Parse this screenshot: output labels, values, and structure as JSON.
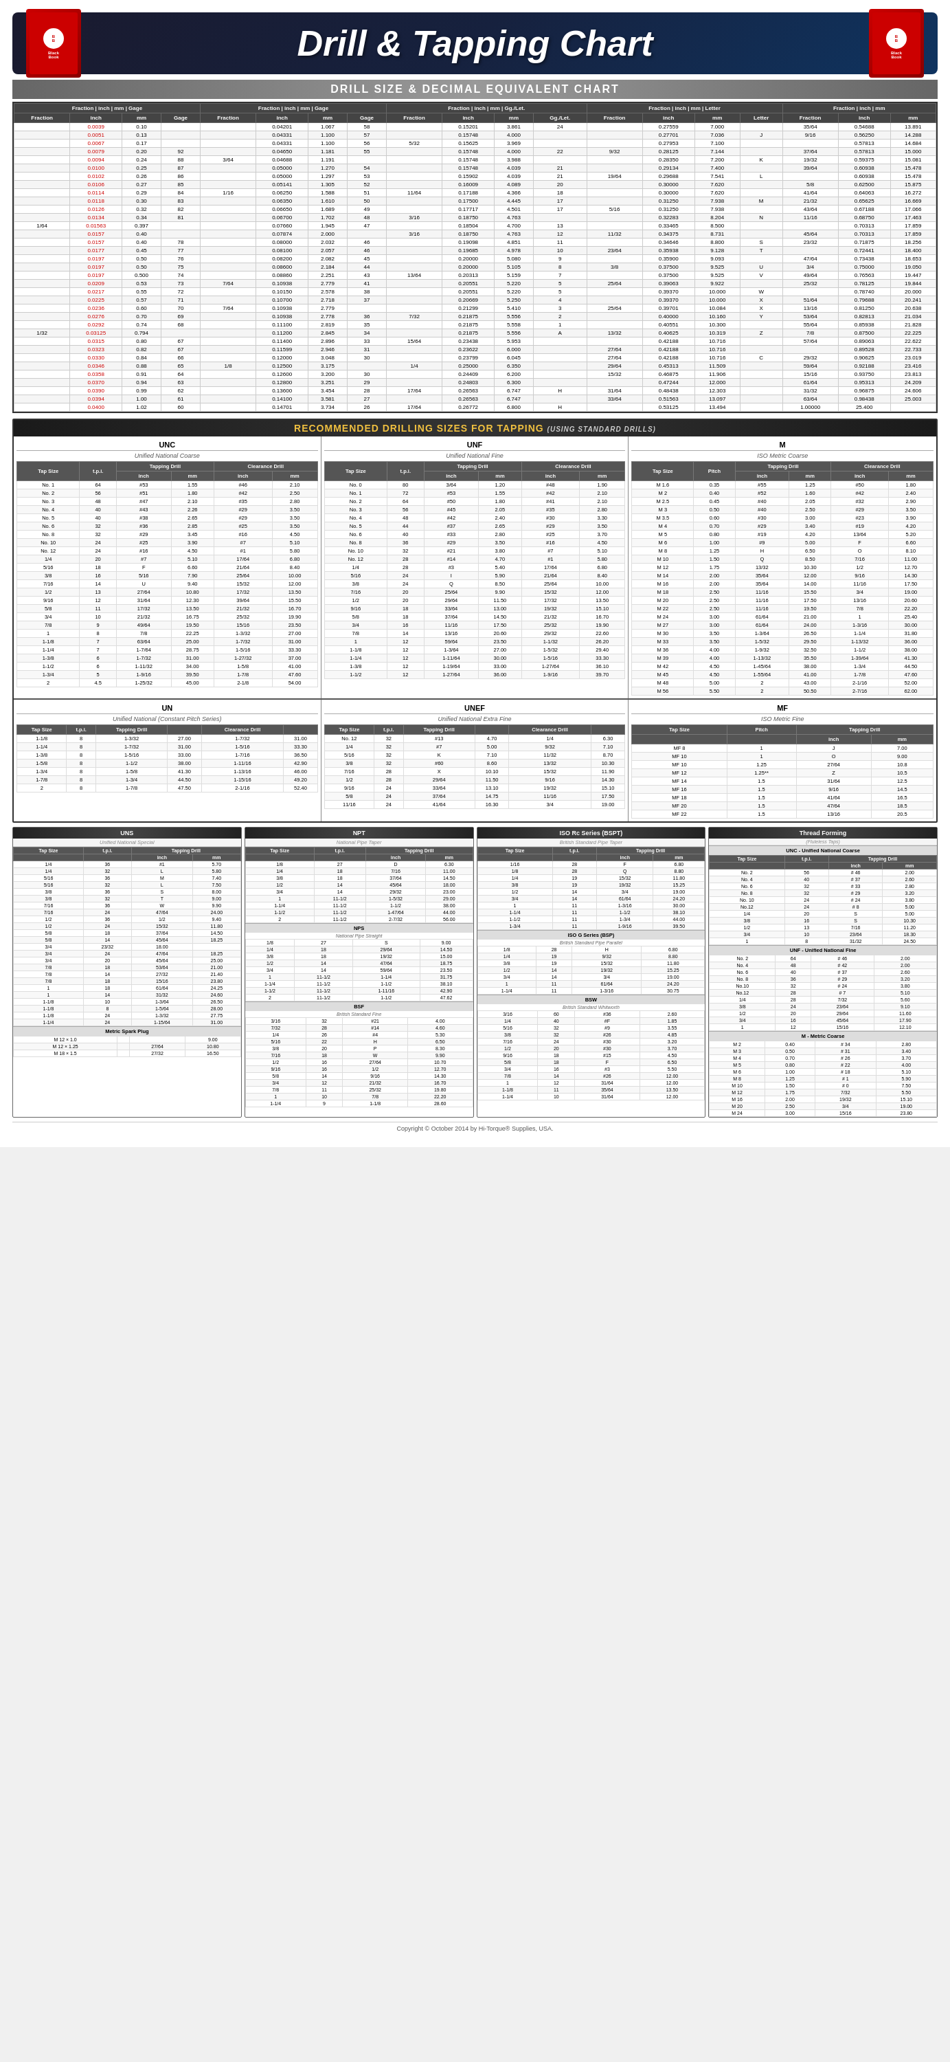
{
  "header": {
    "title": "Drill & Tapping Chart",
    "subtitle": "DRILL SIZE & DECIMAL EQUIVALENT CHART",
    "book_label": "Black Book",
    "drill_subtitle": "RECOMMENDED DRILLING SIZES FOR TAPPING (USING STANDARD DRILLS)"
  },
  "main_table_headers": [
    "Fraction",
    "inch",
    "mm",
    "Gage",
    "Fraction",
    "inch",
    "mm",
    "Gage",
    "Fraction",
    "inch",
    "mm",
    "Gg./Let.",
    "Fraction",
    "inch",
    "mm",
    "Letter",
    "Fraction",
    "inch",
    "mm"
  ],
  "unc_section": {
    "title": "UNC",
    "subtitle": "Unified National Coarse",
    "columns": [
      "Tap Size",
      "t.p.i.",
      "Tapping Drill inch",
      "Tapping Drill mm",
      "Clearance Drill inch",
      "Clearance Drill mm"
    ]
  },
  "unf_section": {
    "title": "UNF",
    "subtitle": "Unified National Fine",
    "columns": [
      "Tap Size",
      "t.p.i.",
      "Tapping Drill inch",
      "Tapping Drill mm",
      "Clearance Drill inch",
      "Clearance Drill mm"
    ]
  },
  "m_section": {
    "title": "M",
    "subtitle": "ISO Metric Coarse",
    "columns": [
      "Tap Size",
      "Pitch",
      "Tapping Drill inch",
      "Tapping Drill mm",
      "Clearance Drill inch",
      "Clearance Drill mm"
    ]
  },
  "un_section": {
    "title": "UN",
    "subtitle": "Unified National (Constant Pitch Series)"
  },
  "unef_section": {
    "title": "UNEF",
    "subtitle": "Unified National Extra Fine"
  },
  "mf_section": {
    "title": "MF",
    "subtitle": "ISO Metric Fine"
  },
  "uns_section": {
    "title": "UNS",
    "subtitle": "Unified National Special"
  },
  "npt_section": {
    "title": "NPT",
    "subtitle": "National Pipe Taper"
  },
  "iso_rc_section": {
    "title": "ISO Rc Series (BSPT)",
    "subtitle": "British Standard Pipe Taper"
  },
  "thread_forming": {
    "title": "Thread Forming",
    "subtitle": "(Fluteless Taps)"
  },
  "metric_spark_plug": {
    "label": "Metric Spark Plug"
  },
  "footer": {
    "copyright": "Copyright © October 2014 by Hi-Torque® Supplies, USA."
  },
  "unc_data": [
    [
      "No. 1",
      "64",
      "#53",
      "1.55",
      "#46",
      "2.10"
    ],
    [
      "No. 2",
      "56",
      "#51",
      "1.80",
      "#42",
      "2.50"
    ],
    [
      "No. 3",
      "48",
      "#47",
      "2.10",
      "#35",
      "2.80"
    ],
    [
      "No. 4",
      "40",
      "#43",
      "2.26",
      "#29",
      "3.50"
    ],
    [
      "No. 5",
      "40",
      "#38",
      "2.65",
      "#29",
      "3.50"
    ],
    [
      "No. 6",
      "32",
      "#36",
      "2.85",
      "#25",
      "3.50"
    ],
    [
      "No. 8",
      "32",
      "#29",
      "3.45",
      "#16",
      "4.50"
    ],
    [
      "No. 10",
      "24",
      "#25",
      "3.90",
      "#7",
      "5.10"
    ],
    [
      "No. 12",
      "24",
      "#16",
      "4.50",
      "#1",
      "5.80"
    ],
    [
      "1/4",
      "20",
      "#7",
      "5.10",
      "17/64",
      "6.80"
    ],
    [
      "5/16",
      "18",
      "F",
      "6.60",
      "21/64",
      "8.40"
    ],
    [
      "3/8",
      "16",
      "5/16",
      "7.90",
      "25/64",
      "10.00"
    ],
    [
      "7/16",
      "14",
      "U",
      "9.40",
      "15/32",
      "12.00"
    ],
    [
      "1/2",
      "13",
      "27/64",
      "10.80",
      "17/32",
      "13.50"
    ],
    [
      "9/16",
      "12",
      "31/64",
      "12.30",
      "39/64",
      "15.50"
    ],
    [
      "5/8",
      "11",
      "17/32",
      "13.50",
      "21/32",
      "16.70"
    ],
    [
      "3/4",
      "10",
      "21/32",
      "16.75",
      "25/32",
      "19.90"
    ],
    [
      "7/8",
      "9",
      "49/64",
      "19.50",
      "15/16",
      "23.50"
    ],
    [
      "1",
      "8",
      "7/8",
      "22.25",
      "1-3/32",
      "27.00"
    ],
    [
      "1-1/8",
      "7",
      "63/64",
      "25.00",
      "1-7/32",
      "31.00"
    ],
    [
      "1-1/4",
      "7",
      "1-7/64",
      "28.75",
      "1-5/16",
      "33.30"
    ],
    [
      "1-3/8",
      "6",
      "1-7/32",
      "31.00",
      "1-27/32",
      "37.00"
    ],
    [
      "1-1/2",
      "6",
      "1-11/32",
      "34.00",
      "1-5/8",
      "41.00"
    ],
    [
      "1-3/4",
      "5",
      "1-9/16",
      "39.50",
      "1-7/8",
      "47.60"
    ],
    [
      "2",
      "4.5",
      "1-25/32",
      "45.00",
      "2-1/8",
      "54.00"
    ]
  ],
  "unf_data": [
    [
      "No. 0",
      "80",
      "3/64",
      "1.20",
      "#48",
      "1.90"
    ],
    [
      "No. 1",
      "72",
      "#53",
      "1.55",
      "#42",
      "2.10"
    ],
    [
      "No. 2",
      "64",
      "#50",
      "1.80",
      "#41",
      "2.10"
    ],
    [
      "No. 3",
      "56",
      "#45",
      "2.05",
      "#35",
      "2.80"
    ],
    [
      "No. 4",
      "48",
      "#42",
      "2.40",
      "#30",
      "3.30"
    ],
    [
      "No. 5",
      "44",
      "#37",
      "2.65",
      "#29",
      "3.50"
    ],
    [
      "No. 6",
      "40",
      "#33",
      "2.80",
      "#25",
      "3.70"
    ],
    [
      "No. 8",
      "36",
      "#29",
      "3.50",
      "#16",
      "4.50"
    ],
    [
      "No. 10",
      "32",
      "#21",
      "3.80",
      "#7",
      "5.10"
    ],
    [
      "No. 12",
      "28",
      "#14",
      "4.70",
      "#1",
      "5.80"
    ],
    [
      "1/4",
      "28",
      "#3",
      "5.40",
      "17/64",
      "6.80"
    ],
    [
      "5/16",
      "24",
      "I",
      "5.90",
      "21/64",
      "8.40"
    ],
    [
      "3/8",
      "24",
      "Q",
      "8.50",
      "25/64",
      "10.00"
    ],
    [
      "7/16",
      "20",
      "25/64",
      "9.90",
      "15/32",
      "12.00"
    ],
    [
      "1/2",
      "20",
      "29/64",
      "11.50",
      "17/32",
      "13.50"
    ],
    [
      "9/16",
      "18",
      "33/64",
      "13.00",
      "19/32",
      "15.10"
    ],
    [
      "5/8",
      "18",
      "37/64",
      "14.50",
      "21/32",
      "16.70"
    ],
    [
      "3/4",
      "16",
      "11/16",
      "17.50",
      "25/32",
      "19.90"
    ],
    [
      "7/8",
      "14",
      "13/16",
      "20.60",
      "29/32",
      "22.60"
    ],
    [
      "1",
      "12",
      "59/64",
      "23.50",
      "1-1/32",
      "26.20"
    ],
    [
      "1-1/8",
      "12",
      "1-3/64",
      "27.00",
      "1-5/32",
      "29.40"
    ],
    [
      "1-1/4",
      "12",
      "1-11/64",
      "30.00",
      "1-5/16",
      "33.30"
    ],
    [
      "1-3/8",
      "12",
      "1-19/64",
      "33.00",
      "1-27/64",
      "36.10"
    ],
    [
      "1-1/2",
      "12",
      "1-27/64",
      "36.00",
      "1-9/16",
      "39.70"
    ]
  ],
  "m_coarse_data": [
    [
      "M 1.6",
      "0.35",
      "#55",
      "1.25",
      "#50",
      "1.80"
    ],
    [
      "M 2",
      "0.40",
      "#52",
      "1.60",
      "#42",
      "2.40"
    ],
    [
      "M 2.5",
      "0.45",
      "#40",
      "2.05",
      "#32",
      "2.90"
    ],
    [
      "M 3",
      "0.50",
      "#40",
      "2.50",
      "#29",
      "3.50"
    ],
    [
      "M 3.5",
      "0.60",
      "#30",
      "3.00",
      "#23",
      "3.90"
    ],
    [
      "M 4",
      "0.70",
      "#29",
      "3.40",
      "#19",
      "4.20"
    ],
    [
      "M 5",
      "0.80",
      "#19",
      "4.20",
      "13/64",
      "5.20"
    ],
    [
      "M 6",
      "1.00",
      "#9",
      "5.00",
      "F",
      "6.60"
    ],
    [
      "M 8",
      "1.25",
      "H",
      "6.50",
      "O",
      "8.10"
    ],
    [
      "M 10",
      "1.50",
      "Q",
      "8.50",
      "7/16",
      "11.00"
    ],
    [
      "M 12",
      "1.75",
      "13/32",
      "10.30",
      "1/2",
      "12.70"
    ],
    [
      "M 14",
      "2.00",
      "35/64",
      "12.00",
      "9/16",
      "14.30"
    ],
    [
      "M 16",
      "2.00",
      "35/64",
      "14.00",
      "11/16",
      "17.50"
    ],
    [
      "M 18",
      "2.50",
      "11/16",
      "15.50",
      "3/4",
      "19.00"
    ],
    [
      "M 20",
      "2.50",
      "11/16",
      "17.50",
      "13/16",
      "20.60"
    ],
    [
      "M 22",
      "2.50",
      "11/16",
      "19.50",
      "7/8",
      "22.20"
    ],
    [
      "M 24",
      "3.00",
      "61/64",
      "21.00",
      "1",
      "25.40"
    ],
    [
      "M 27",
      "3.00",
      "61/64",
      "24.00",
      "1-3/16",
      "30.00"
    ],
    [
      "M 30",
      "3.50",
      "1-3/64",
      "26.50",
      "1-1/4",
      "31.80"
    ],
    [
      "M 33",
      "3.50",
      "1-5/32",
      "29.50",
      "1-13/32",
      "36.00"
    ],
    [
      "M 36",
      "4.00",
      "1-9/32",
      "32.50",
      "1-1/2",
      "38.00"
    ],
    [
      "M 39",
      "4.00",
      "1-13/32",
      "35.50",
      "1-39/64",
      "41.30"
    ],
    [
      "M 42",
      "4.50",
      "1-45/64",
      "38.00",
      "1-3/4",
      "44.50"
    ],
    [
      "M 45",
      "4.50",
      "1-55/64",
      "41.00",
      "1-7/8",
      "47.60"
    ],
    [
      "M 48",
      "5.00",
      "2",
      "43.00",
      "2-1/16",
      "52.00"
    ],
    [
      "M 56",
      "5.50",
      "2",
      "50.50",
      "2-7/16",
      "62.00"
    ]
  ],
  "colors": {
    "header_bg": "#1a1a2e",
    "section_header_bg": "#222",
    "table_header_bg": "#555",
    "accent_yellow": "#f0c040",
    "red": "#cc0000",
    "blue": "#0000cc",
    "green": "#006600"
  }
}
